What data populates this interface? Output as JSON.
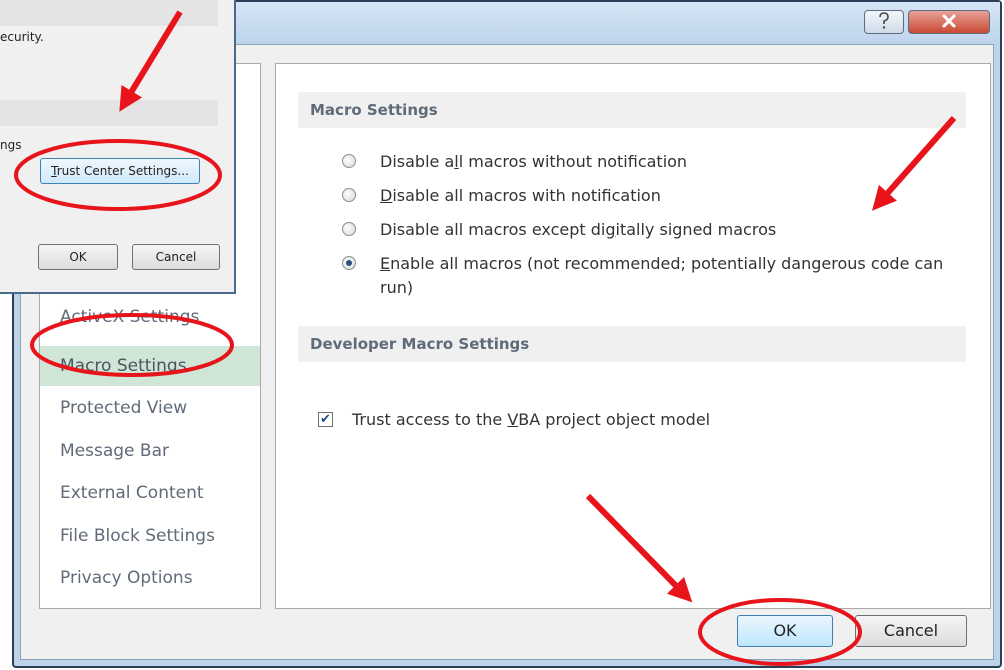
{
  "nav": {
    "items": [
      {
        "label": "ActiveX Settings",
        "selected": false
      },
      {
        "label": "Macro Settings",
        "selected": true
      },
      {
        "label": "Protected View",
        "selected": false
      },
      {
        "label": "Message Bar",
        "selected": false
      },
      {
        "label": "External Content",
        "selected": false
      },
      {
        "label": "File Block Settings",
        "selected": false
      },
      {
        "label": "Privacy Options",
        "selected": false
      }
    ]
  },
  "macro_settings": {
    "header": "Macro Settings",
    "options": [
      {
        "label": "Disable all macros without notification",
        "checked": false
      },
      {
        "label": "Disable all macros with notification",
        "checked": false
      },
      {
        "label": "Disable all macros except digitally signed macros",
        "checked": false
      },
      {
        "label": "Enable all macros (not recommended; potentially dangerous code can run)",
        "checked": true
      }
    ]
  },
  "developer": {
    "header": "Developer Macro Settings",
    "vba_label": "Trust access to the VBA project object model",
    "vba_checked": true
  },
  "buttons": {
    "ok": "OK",
    "cancel": "Cancel"
  },
  "small_dialog": {
    "text_1": "ecurity.",
    "text_2": "ngs",
    "trust_center_button": "Trust Center Settings...",
    "ok": "OK",
    "cancel": "Cancel"
  },
  "colors": {
    "annotation_red": "#e8141b",
    "selected_nav": "#cfe5d5"
  },
  "icons": {
    "help": "question-mark",
    "close": "x-mark"
  }
}
